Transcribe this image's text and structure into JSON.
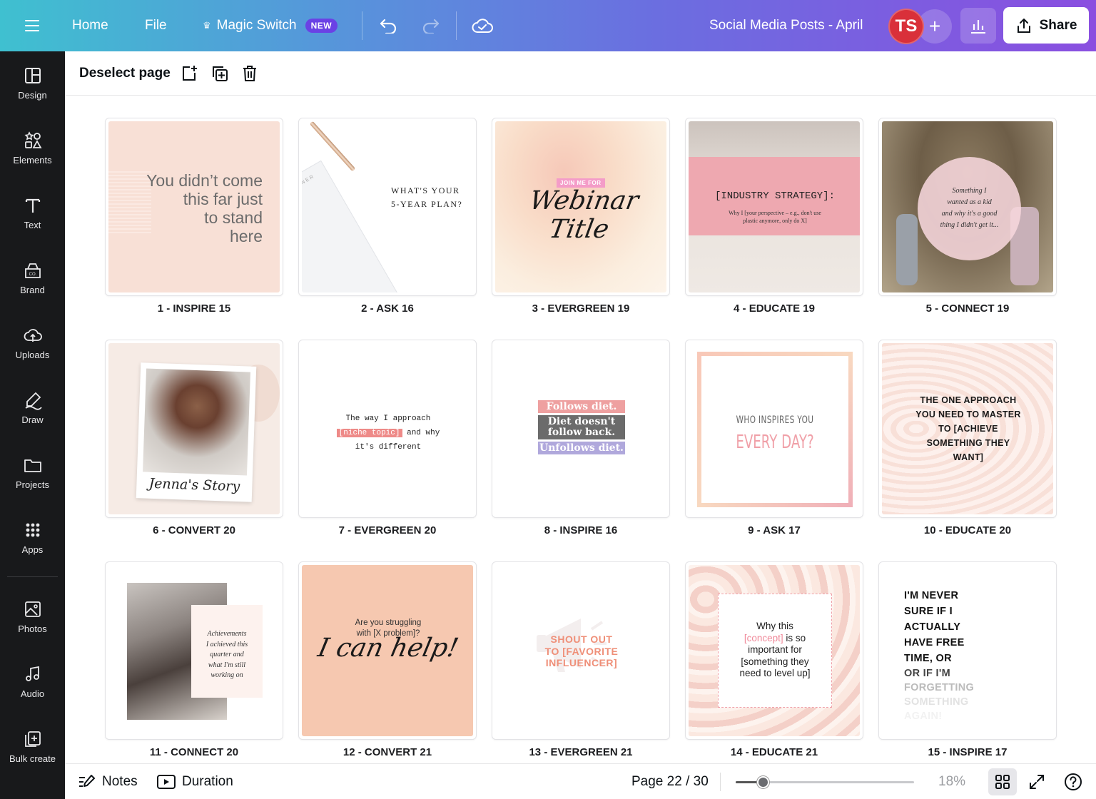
{
  "topbar": {
    "home": "Home",
    "file": "File",
    "magic_switch": "Magic Switch",
    "new_badge": "NEW",
    "doc_title": "Social Media Posts - April",
    "avatar_initials": "TS",
    "add_label": "+",
    "share": "Share",
    "gradient": [
      "#3fc0d0",
      "#5a8fdc",
      "#6b6ee0",
      "#8a4fe0"
    ],
    "avatar_color": "#d9303a"
  },
  "sidebar": {
    "items": [
      {
        "label": "Design",
        "icon": "layout-icon"
      },
      {
        "label": "Elements",
        "icon": "shapes-icon"
      },
      {
        "label": "Text",
        "icon": "text-icon"
      },
      {
        "label": "Brand",
        "icon": "brand-icon"
      },
      {
        "label": "Uploads",
        "icon": "cloud-upload-icon"
      },
      {
        "label": "Draw",
        "icon": "pen-icon"
      },
      {
        "label": "Projects",
        "icon": "folder-icon"
      },
      {
        "label": "Apps",
        "icon": "apps-grid-icon"
      },
      {
        "label": "Photos",
        "icon": "image-icon"
      },
      {
        "label": "Audio",
        "icon": "music-note-icon"
      },
      {
        "label": "Bulk create",
        "icon": "bulk-create-icon"
      }
    ]
  },
  "toolbar": {
    "deselect": "Deselect page"
  },
  "pages": [
    {
      "label": "1 - INSPIRE 15",
      "lines": [
        "You didn’t come",
        "this far just",
        "to stand",
        "here"
      ]
    },
    {
      "label": "2 - ASK 16",
      "lines": [
        "WHAT'S YOUR",
        "5-YEAR PLAN?"
      ],
      "planner": "YEARLY PLANNER"
    },
    {
      "label": "3 - EVERGREEN 19",
      "tag": "JOIN ME FOR",
      "lines": [
        "Webinar",
        "Title"
      ]
    },
    {
      "label": "4 - EDUCATE 19",
      "lines": [
        "[INDUSTRY STRATEGY]:",
        "Why I [your perspective – e.g., don't use",
        "plastic anymore, only do X]"
      ]
    },
    {
      "label": "5 - CONNECT 19",
      "lines": [
        "Something I",
        "wanted as a kid",
        "and why it's a good",
        "thing I didn't get it..."
      ]
    },
    {
      "label": "6 - CONVERT 20",
      "lines": [
        "Jenna's Story"
      ]
    },
    {
      "label": "7 - EVERGREEN 20",
      "lines": [
        "The way I approach",
        "[niche topic]",
        "and why",
        "it's different"
      ]
    },
    {
      "label": "8 - INSPIRE 16",
      "lines": [
        "Follows diet.",
        "Diet doesn't",
        "follow back.",
        "Unfollows diet."
      ]
    },
    {
      "label": "9 - ASK 17",
      "lines": [
        "WHO INSPIRES YOU",
        "EVERY DAY?"
      ]
    },
    {
      "label": "10 - EDUCATE 20",
      "lines": [
        "THE ONE APPROACH",
        "YOU NEED TO MASTER",
        "TO [ACHIEVE",
        "SOMETHING THEY",
        "WANT]"
      ]
    },
    {
      "label": "11 - CONNECT 20",
      "lines": [
        "Achievements",
        "I achieved this",
        "quarter and",
        "what I'm still",
        "working on"
      ]
    },
    {
      "label": "12 - CONVERT 21",
      "lines": [
        "Are you struggling",
        "with [X problem]?",
        "I can help!"
      ]
    },
    {
      "label": "13 - EVERGREEN 21",
      "lines": [
        "SHOUT OUT",
        "TO [FAVORITE",
        "INFLUENCER]"
      ]
    },
    {
      "label": "14 - EDUCATE 21",
      "lines": [
        "Why this",
        "[concept]",
        "is so",
        "important for",
        "[something they",
        "need to level up]"
      ]
    },
    {
      "label": "15 - INSPIRE 17",
      "lines": [
        "I'M NEVER",
        "SURE IF I",
        "ACTUALLY",
        "HAVE FREE",
        "TIME, OR",
        "OR IF I'M",
        "FORGETTING",
        "SOMETHING",
        "AGAIN!"
      ]
    }
  ],
  "bottombar": {
    "notes": "Notes",
    "duration": "Duration",
    "page_indicator": "Page 22 / 30",
    "zoom": "18%",
    "zoom_fraction": 0.15
  }
}
